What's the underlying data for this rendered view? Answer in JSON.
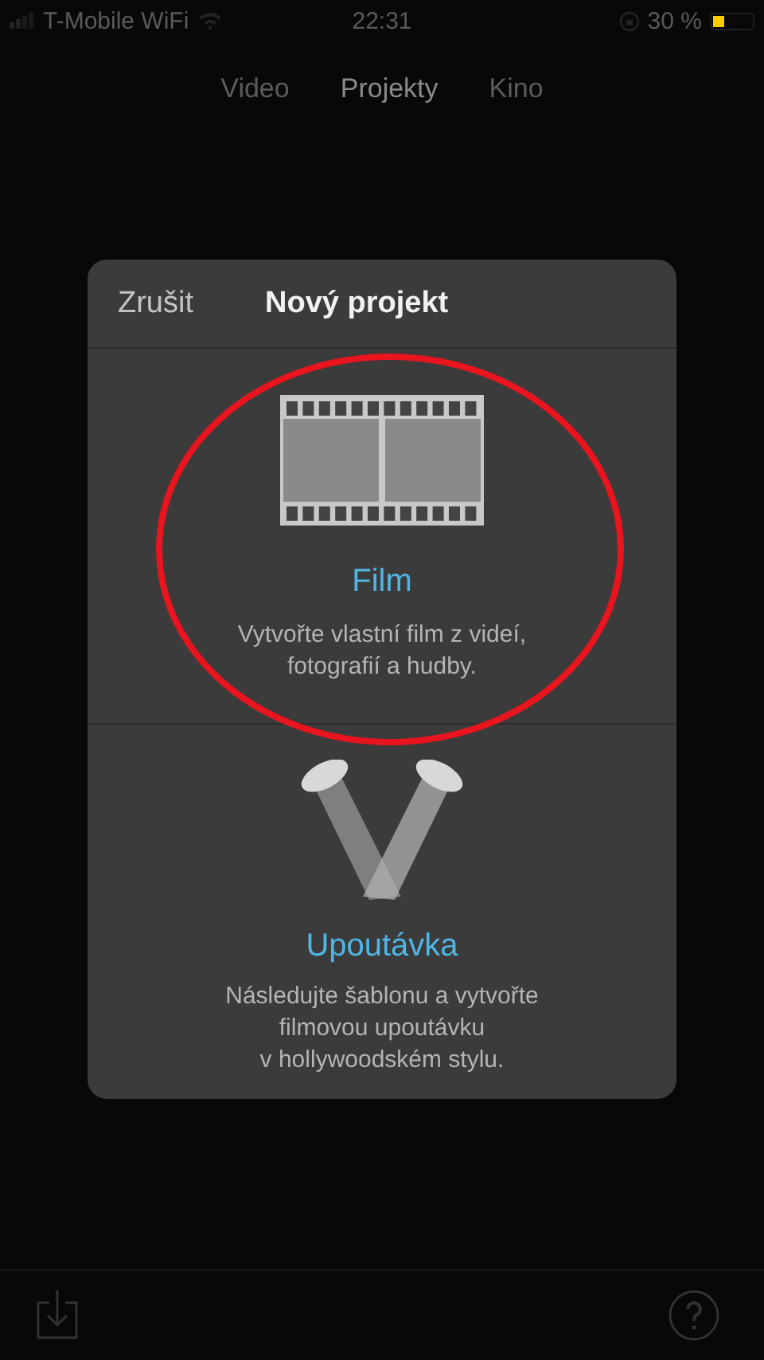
{
  "status_bar": {
    "carrier": "T-Mobile WiFi",
    "time": "22:31",
    "battery_text": "30 %",
    "battery": {
      "level": 0.3
    }
  },
  "tabs": [
    {
      "label": "Video",
      "selected": false
    },
    {
      "label": "Projekty",
      "selected": true
    },
    {
      "label": "Kino",
      "selected": false
    }
  ],
  "dialog": {
    "cancel": "Zrušit",
    "title": "Nový projekt",
    "options": [
      {
        "kind": "film",
        "title": "Film",
        "description": [
          "Vytvořte vlastní film z videí,",
          "fotografií a hudby."
        ],
        "highlighted": true
      },
      {
        "kind": "trailer",
        "title": "Upoutávka",
        "description": [
          "Následujte šablonu a vytvořte",
          "filmovou upoutávku",
          "v hollywoodském stylu."
        ],
        "highlighted": false
      }
    ]
  }
}
